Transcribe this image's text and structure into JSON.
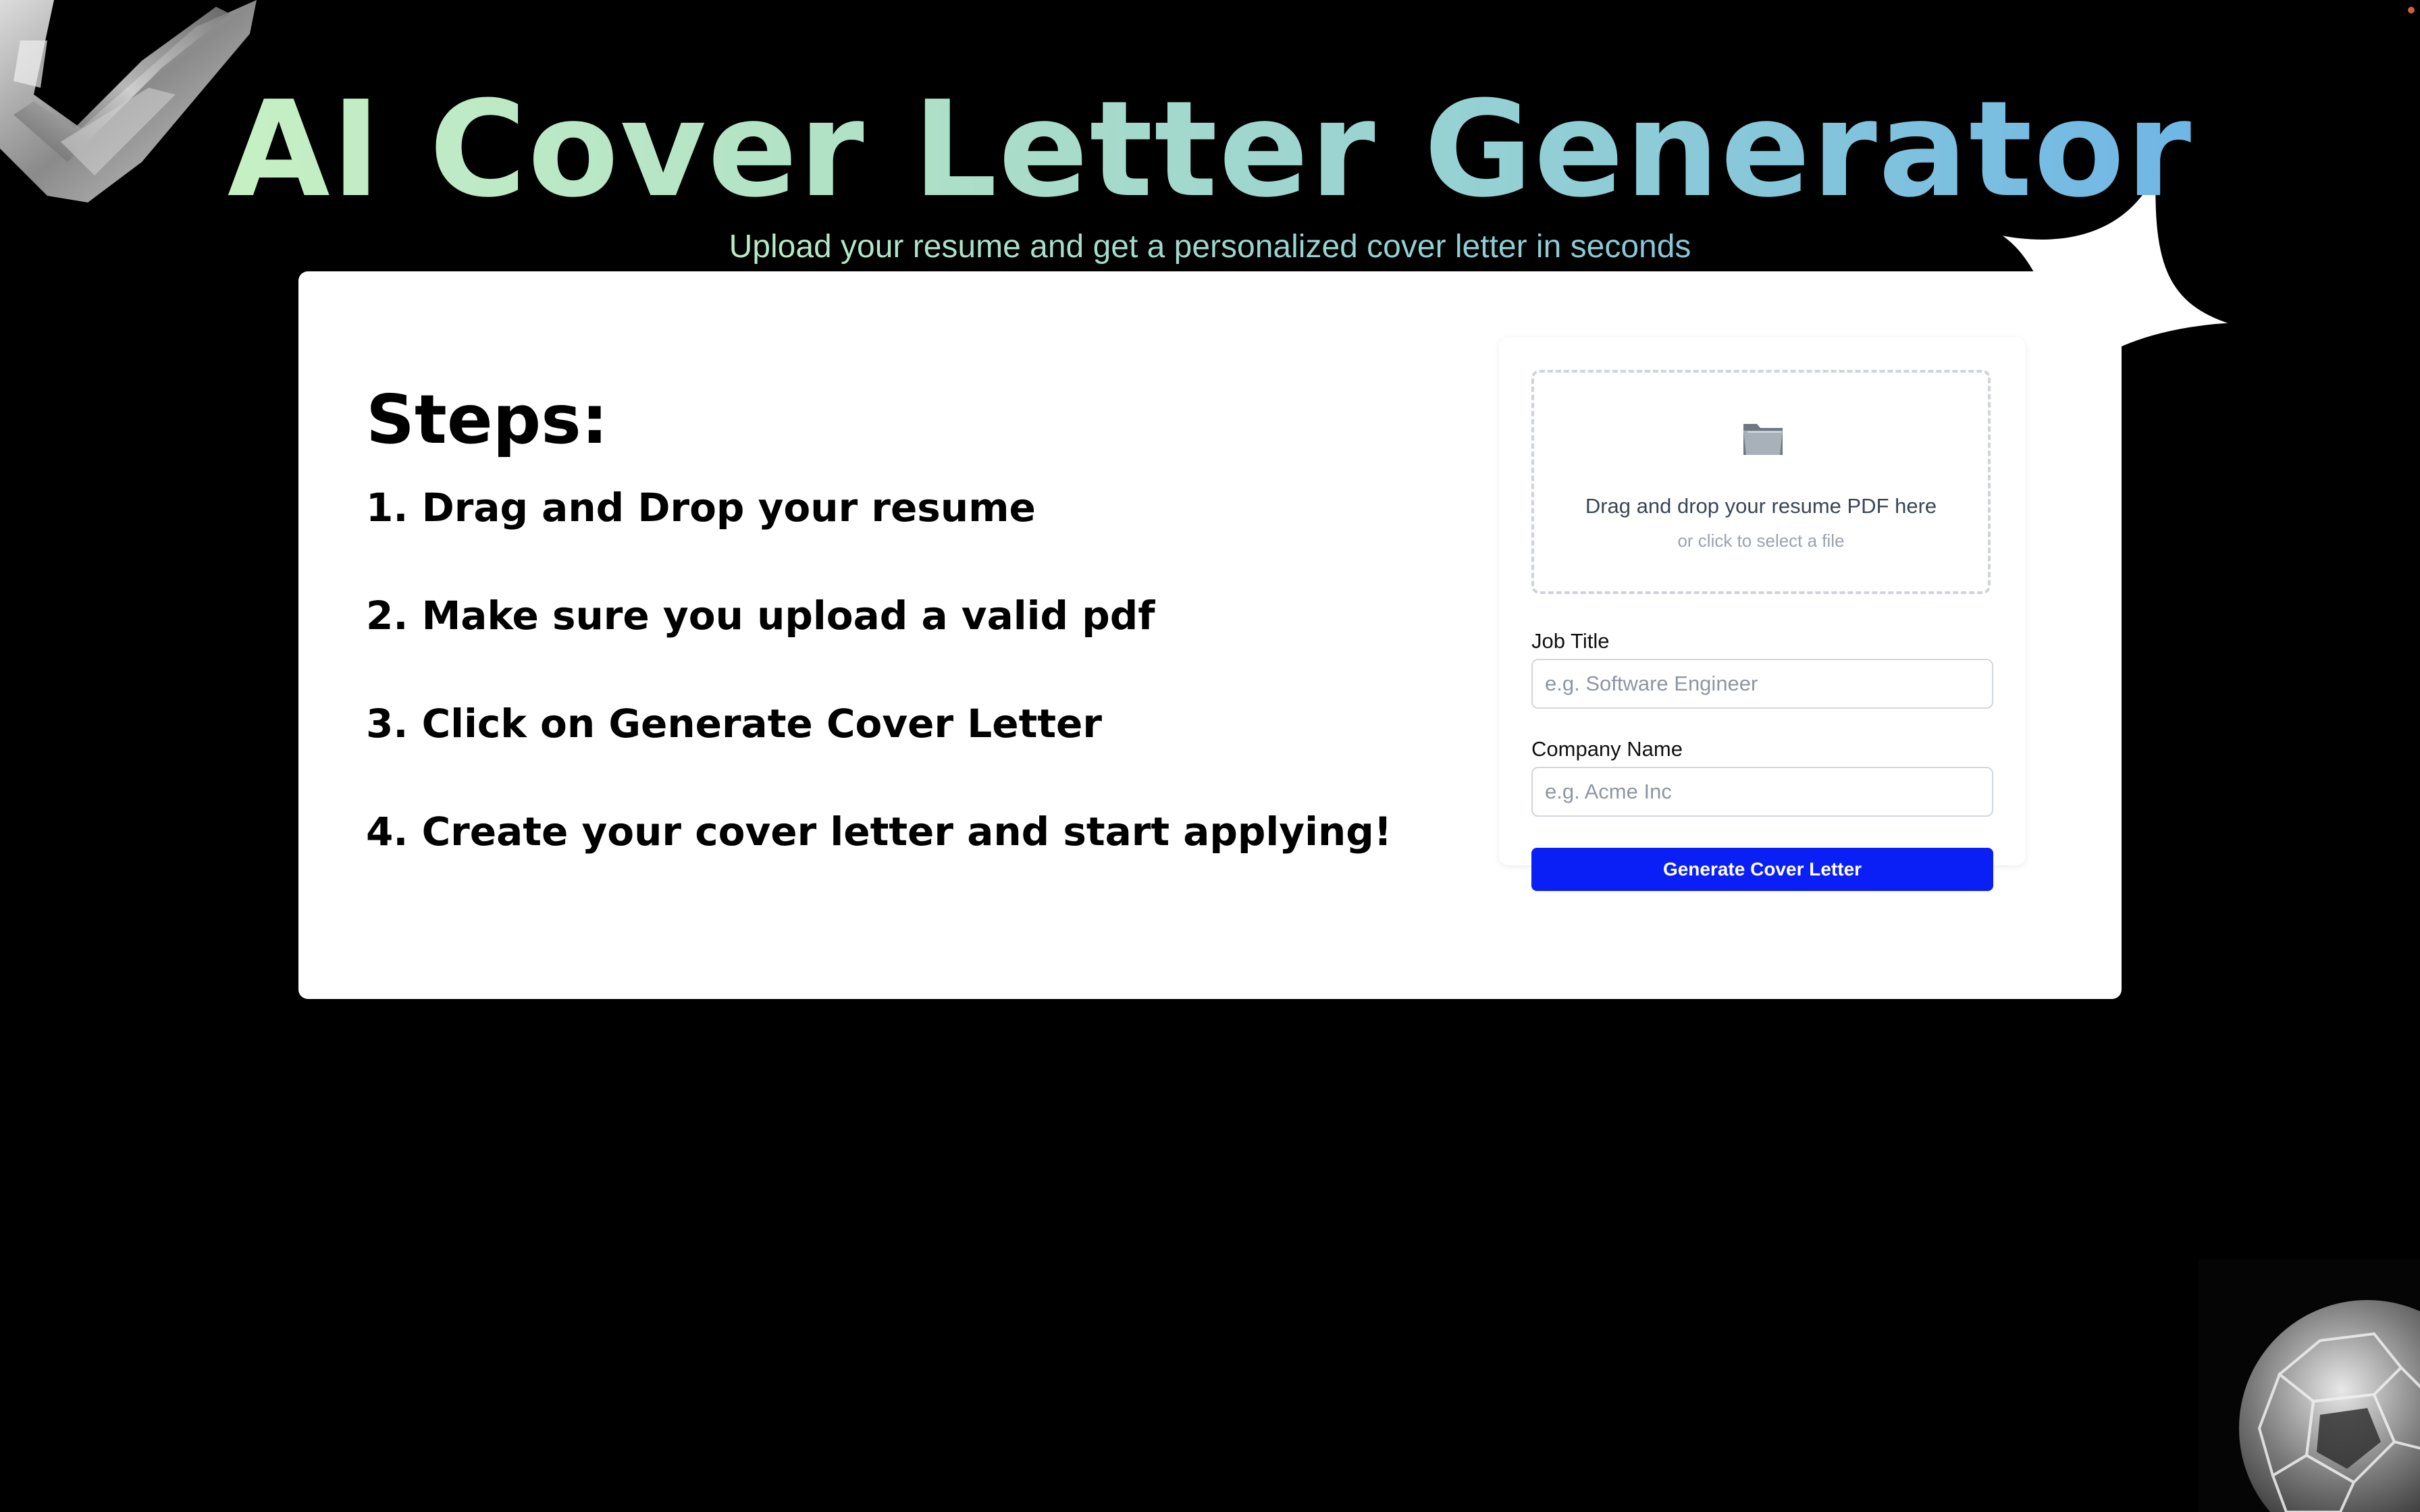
{
  "header": {
    "title": "AI Cover Letter Generator",
    "subtitle": "Upload your resume and get a personalized cover letter in seconds"
  },
  "steps": {
    "heading": "Steps:",
    "items": [
      "1. Drag and Drop your resume",
      "2. Make sure you upload a valid pdf",
      "3. Click on Generate Cover Letter",
      "4. Create your cover letter and start applying!"
    ]
  },
  "form": {
    "dropzone": {
      "icon": "folder-icon",
      "title": "Drag and drop your resume PDF here",
      "subtitle": "or click to select a file"
    },
    "job_title": {
      "label": "Job Title",
      "value": "",
      "placeholder": "e.g. Software Engineer"
    },
    "company_name": {
      "label": "Company Name",
      "value": "",
      "placeholder": "e.g. Acme Inc"
    },
    "generate_label": "Generate Cover Letter"
  },
  "colors": {
    "background": "#000000",
    "card": "#ffffff",
    "button": "#0a1ff5",
    "title_gradient_start": "#c6f0c4",
    "title_gradient_end": "#6fb6e6"
  }
}
